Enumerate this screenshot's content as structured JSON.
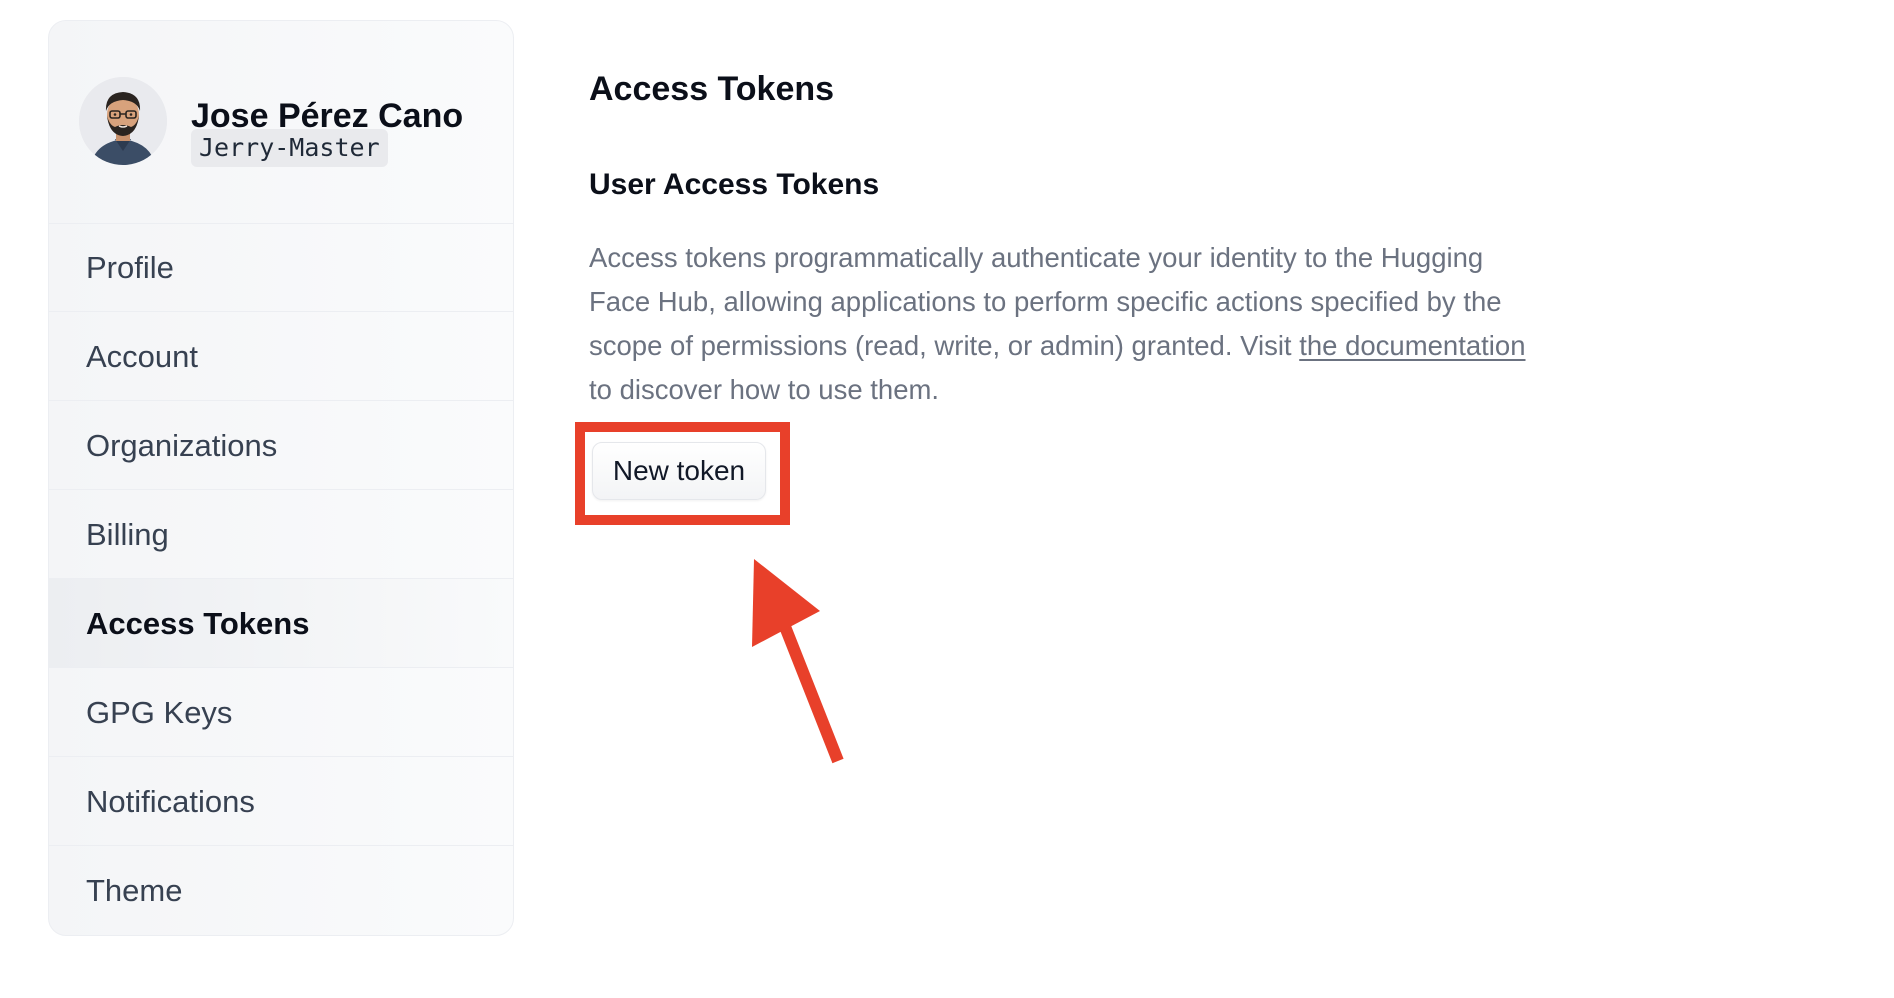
{
  "user": {
    "display_name": "Jose Pérez Cano",
    "username": "Jerry-Master"
  },
  "sidebar": {
    "items": [
      {
        "label": "Profile",
        "active": false
      },
      {
        "label": "Account",
        "active": false
      },
      {
        "label": "Organizations",
        "active": false
      },
      {
        "label": "Billing",
        "active": false
      },
      {
        "label": "Access Tokens",
        "active": true
      },
      {
        "label": "GPG Keys",
        "active": false
      },
      {
        "label": "Notifications",
        "active": false
      },
      {
        "label": "Theme",
        "active": false
      }
    ]
  },
  "main": {
    "title": "Access Tokens",
    "section_title": "User Access Tokens",
    "description_before_link": "Access tokens programmatically authenticate your identity to the Hugging Face Hub, allowing applications to perform specific actions specified by the scope of permissions (read, write, or admin) granted. Visit ",
    "description_link": "the documentation",
    "description_after_link": " to discover how to use them.",
    "new_token_label": "New token"
  },
  "annotation": {
    "highlight_color": "#e8402a"
  }
}
